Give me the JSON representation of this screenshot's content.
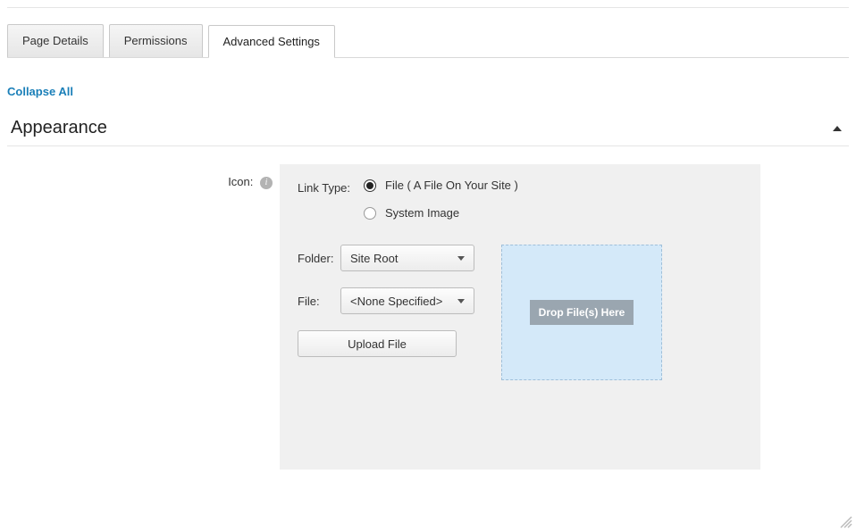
{
  "tabs": {
    "page_details": "Page Details",
    "permissions": "Permissions",
    "advanced_settings": "Advanced Settings"
  },
  "collapse_all": "Collapse All",
  "section": {
    "title": "Appearance"
  },
  "form": {
    "icon_label": "Icon:",
    "link_type_label": "Link Type:",
    "radio_file": "File ( A File On Your Site )",
    "radio_system_image": "System Image",
    "folder_label": "Folder:",
    "folder_value": "Site Root",
    "file_label": "File:",
    "file_value": "<None Specified>",
    "upload_button": "Upload File",
    "dropzone_text": "Drop File(s) Here"
  }
}
